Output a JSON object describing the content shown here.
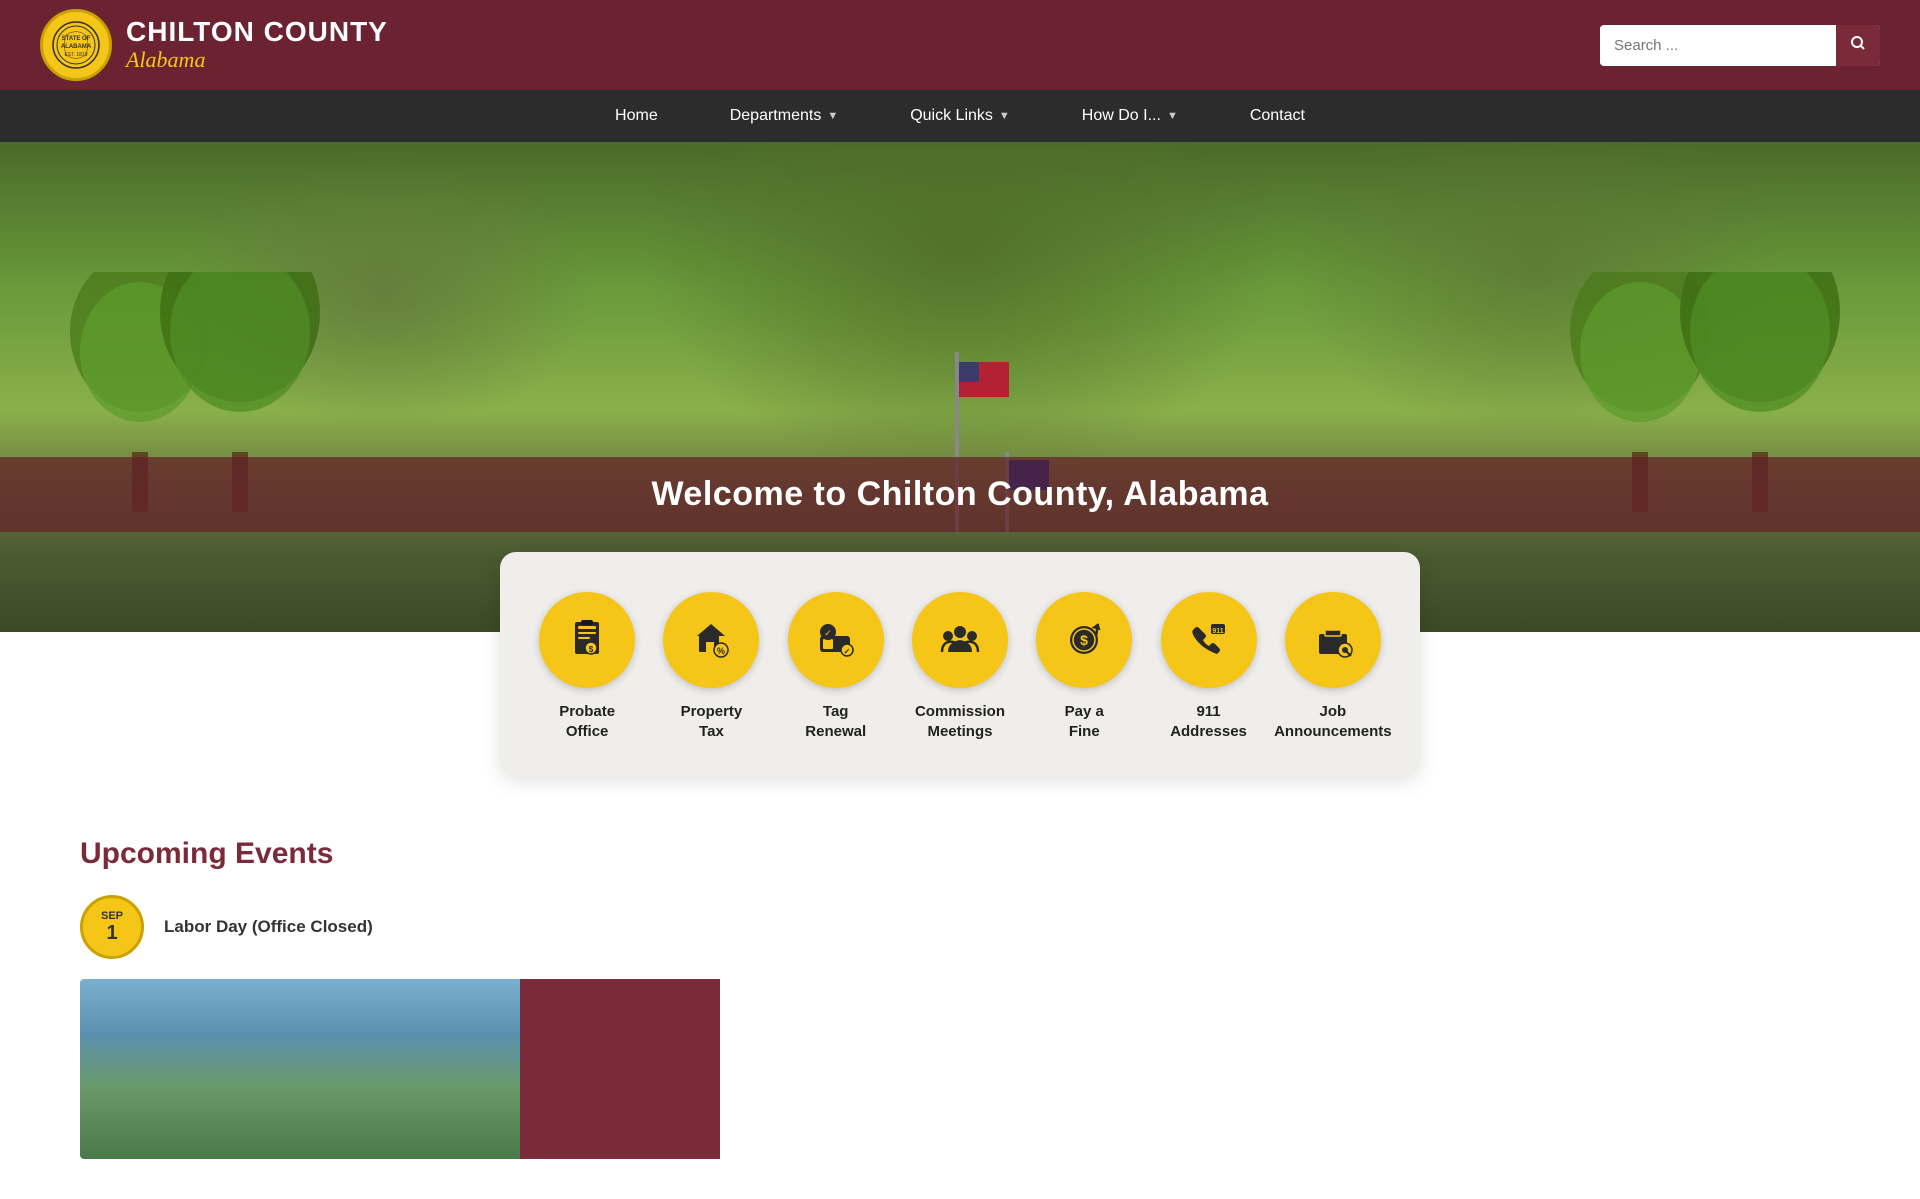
{
  "header": {
    "logo_county": "CHILTON COUNTY",
    "logo_state": "Alabama",
    "search_placeholder": "Search ..."
  },
  "nav": {
    "items": [
      {
        "label": "Home",
        "has_chevron": false
      },
      {
        "label": "Departments",
        "has_chevron": true
      },
      {
        "label": "Quick Links",
        "has_chevron": true
      },
      {
        "label": "How Do I...",
        "has_chevron": true
      },
      {
        "label": "Contact",
        "has_chevron": false
      }
    ]
  },
  "hero": {
    "welcome_text": "Welcome to Chilton County, Alabama"
  },
  "quick_links": {
    "items": [
      {
        "label": "Probate\nOffice",
        "icon": "probate"
      },
      {
        "label": "Property\nTax",
        "icon": "property-tax"
      },
      {
        "label": "Tag\nRenewal",
        "icon": "tag-renewal"
      },
      {
        "label": "Commission\nMeetings",
        "icon": "commission"
      },
      {
        "label": "Pay a\nFine",
        "icon": "pay-fine"
      },
      {
        "label": "911\nAddresses",
        "icon": "911"
      },
      {
        "label": "Job\nAnnouncements",
        "icon": "jobs"
      }
    ]
  },
  "events": {
    "title": "Upcoming Events",
    "items": [
      {
        "month": "SEP",
        "day": "1",
        "name": "Labor Day (Office Closed)"
      }
    ]
  }
}
